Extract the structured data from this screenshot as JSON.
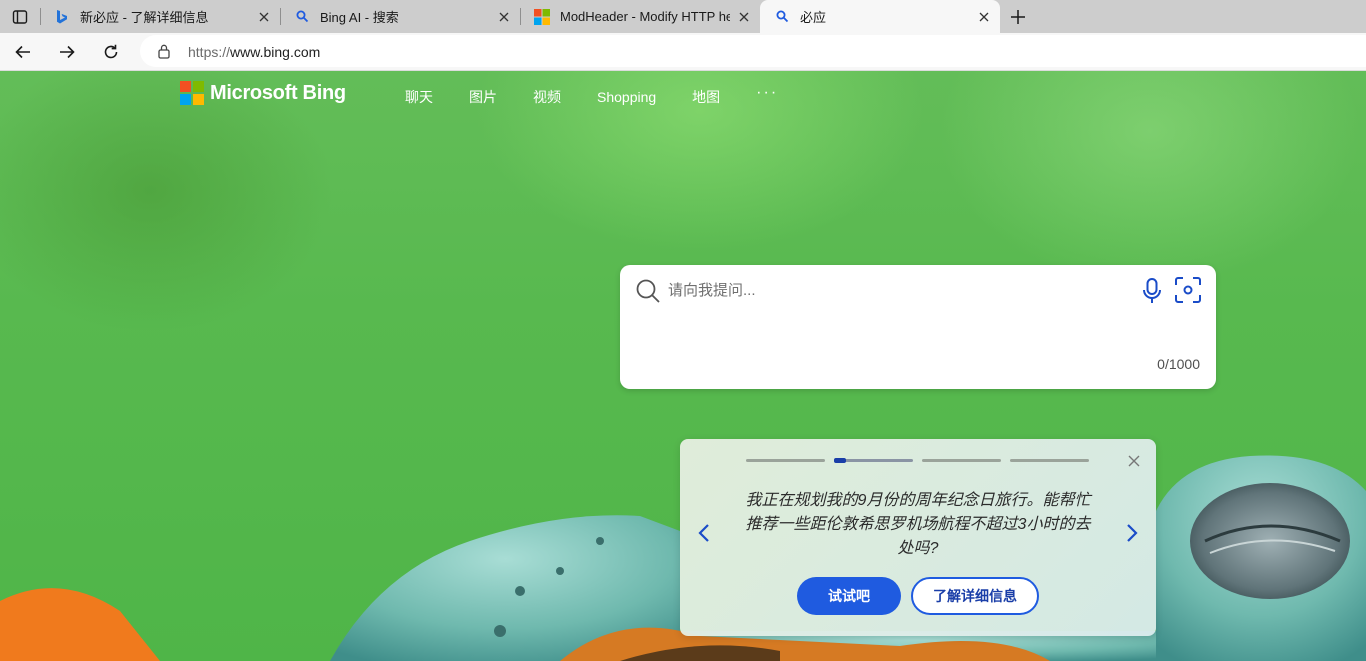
{
  "browser": {
    "tabs": [
      {
        "title": "新必应 - 了解详细信息",
        "icon": "bing-b-icon",
        "active": false
      },
      {
        "title": "Bing AI - 搜索",
        "icon": "search-icon",
        "active": false
      },
      {
        "title": "ModHeader - Modify HTTP headers",
        "icon": "microsoft-logo-icon",
        "active": false
      },
      {
        "title": "必应",
        "icon": "search-icon",
        "active": true
      }
    ],
    "address": {
      "scheme": "https://",
      "host": "www.bing.com"
    }
  },
  "page": {
    "brand": "Microsoft Bing",
    "nav": [
      {
        "label": "聊天"
      },
      {
        "label": "图片"
      },
      {
        "label": "视频"
      },
      {
        "label": "Shopping"
      },
      {
        "label": "地图"
      }
    ],
    "more_label": "···",
    "search": {
      "placeholder": "请向我提问...",
      "counter": "0/1000"
    },
    "suggestion": {
      "prompt": "我正在规划我的9月份的周年纪念日旅行。能帮忙推荐一些距伦敦希思罗机场航程不超过3小时的去处吗?",
      "try_label": "试试吧",
      "learn_label": "了解详细信息",
      "step_count": 4,
      "active_step": 2
    }
  },
  "colors": {
    "accent": "#1f5be0",
    "ms_red": "#f25022",
    "ms_green": "#7fba00",
    "ms_blue": "#00a4ef",
    "ms_yellow": "#ffb900"
  }
}
